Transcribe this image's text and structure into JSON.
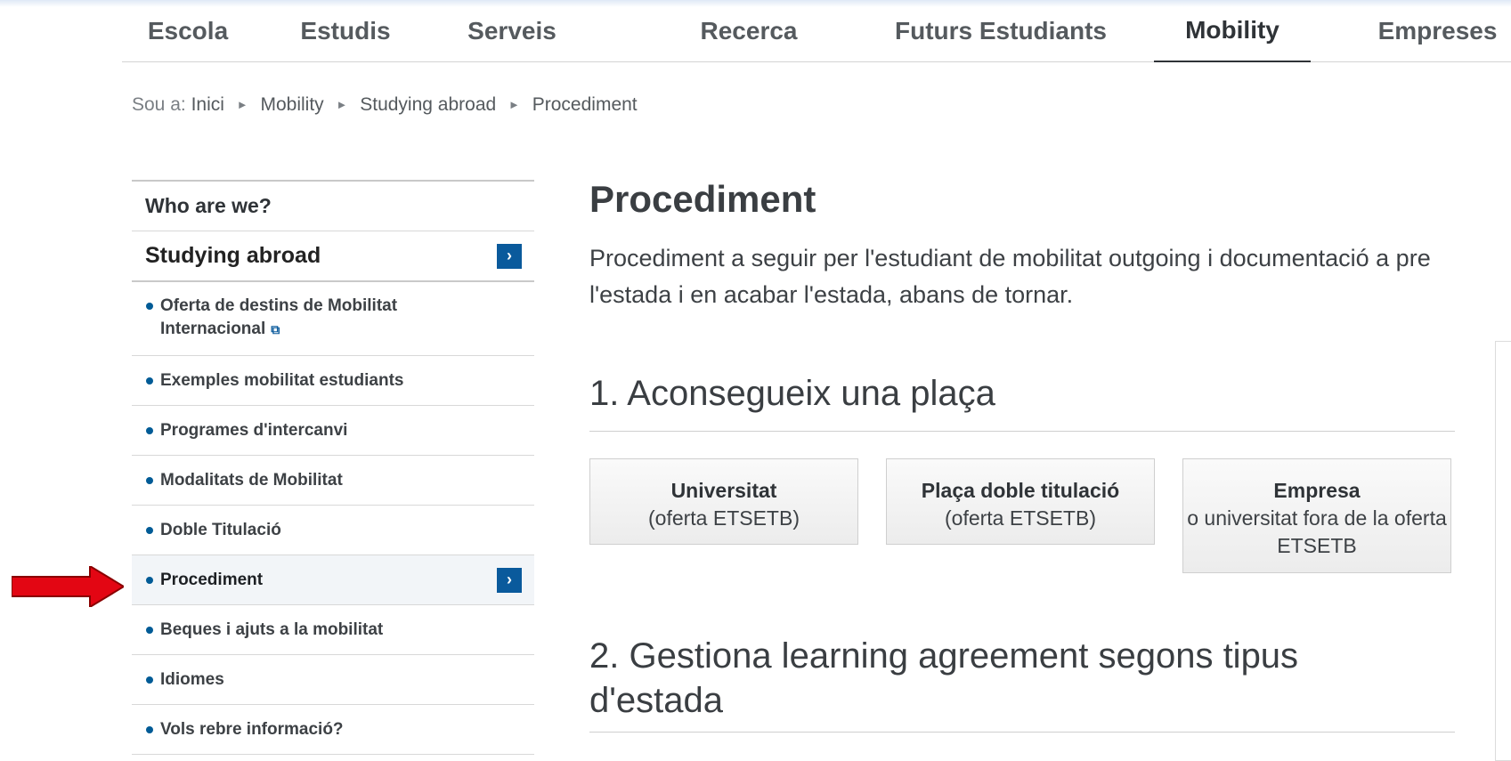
{
  "topnav": {
    "items": [
      {
        "label": "Escola"
      },
      {
        "label": "Estudis"
      },
      {
        "label": "Serveis"
      },
      {
        "label": "Recerca"
      },
      {
        "label": "Futurs Estudiants"
      },
      {
        "label": "Mobility",
        "active": true
      },
      {
        "label": "Empreses"
      }
    ]
  },
  "breadcrumb": {
    "prefix": "Sou a:",
    "items": [
      "Inici",
      "Mobility",
      "Studying abroad",
      "Procediment"
    ]
  },
  "sidebar": {
    "main": [
      {
        "label": "Who are we?"
      },
      {
        "label": "Studying abroad",
        "icon": "chevron-right-icon"
      }
    ],
    "sub": [
      {
        "label": "Oferta de destins de Mobilitat",
        "label2": "Internacional",
        "icon": "external-link-icon"
      },
      {
        "label": "Exemples mobilitat estudiants"
      },
      {
        "label": "Programes d'intercanvi"
      },
      {
        "label": "Modalitats de Mobilitat"
      },
      {
        "label": "Doble Titulació"
      },
      {
        "label": "Procediment",
        "active": true,
        "icon": "chevron-right-icon"
      },
      {
        "label": "Beques i ajuts a la mobilitat"
      },
      {
        "label": "Idiomes"
      },
      {
        "label": "Vols rebre informació?"
      }
    ]
  },
  "main": {
    "title": "Procediment",
    "intro_line1": "Procediment a seguir per l'estudiant de mobilitat outgoing i documentació a pre",
    "intro_line2": "l'estada i en acabar l'estada, abans de tornar.",
    "section1": "1. Aconsegueix una plaça",
    "cards": [
      {
        "title": "Universitat",
        "subtitle": "(oferta ETSETB)"
      },
      {
        "title": "Plaça doble titulació",
        "subtitle": "(oferta ETSETB)"
      },
      {
        "title": "Empresa",
        "subtitle": "o universitat fora de la oferta ETSETB"
      }
    ],
    "section2_line1": "2. Gestiona learning agreement segons tipus",
    "section2_line2": "d'estada"
  },
  "annotation": {
    "icon": "red-arrow-icon",
    "color": "#e30613"
  },
  "colors": {
    "accent": "#0a5a9c",
    "text": "#333333"
  }
}
